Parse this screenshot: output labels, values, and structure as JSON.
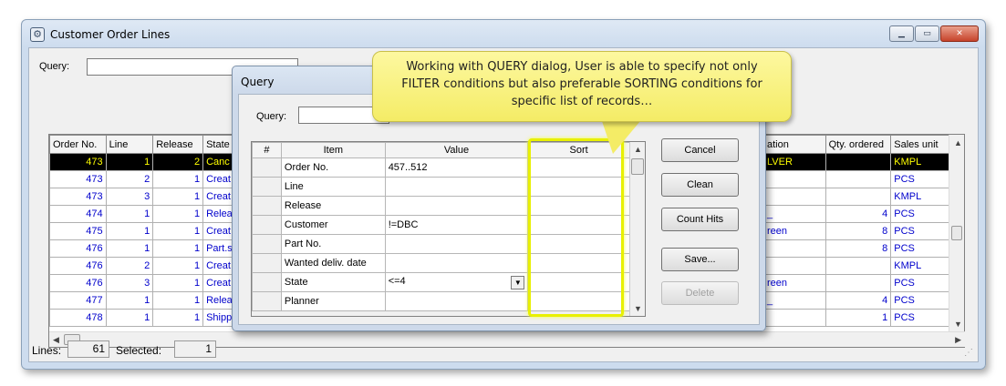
{
  "main": {
    "title": "Customer Order Lines",
    "query_label": "Query:",
    "columns_left": [
      "Order No.",
      "Line",
      "Release",
      "State"
    ],
    "columns_right": [
      "ation",
      "Qty. ordered",
      "Sales unit"
    ],
    "rows": [
      {
        "order": "473",
        "line": "1",
        "release": "2",
        "state": "Canc",
        "loc": "LVER",
        "qty": "",
        "unit": "KMPL",
        "selected": true
      },
      {
        "order": "473",
        "line": "2",
        "release": "1",
        "state": "Creat",
        "loc": "",
        "qty": "",
        "unit": "PCS"
      },
      {
        "order": "473",
        "line": "3",
        "release": "1",
        "state": "Creat",
        "loc": "",
        "qty": "",
        "unit": "KMPL"
      },
      {
        "order": "474",
        "line": "1",
        "release": "1",
        "state": "Relea",
        "loc": "_",
        "qty": "4",
        "unit": "PCS"
      },
      {
        "order": "475",
        "line": "1",
        "release": "1",
        "state": "Creat",
        "loc": "reen",
        "qty": "8",
        "unit": "PCS"
      },
      {
        "order": "476",
        "line": "1",
        "release": "1",
        "state": "Part.s",
        "loc": "",
        "qty": "8",
        "unit": "PCS"
      },
      {
        "order": "476",
        "line": "2",
        "release": "1",
        "state": "Creat",
        "loc": "",
        "qty": "",
        "unit": "KMPL"
      },
      {
        "order": "476",
        "line": "3",
        "release": "1",
        "state": "Creat",
        "loc": "reen",
        "qty": "",
        "unit": "PCS"
      },
      {
        "order": "477",
        "line": "1",
        "release": "1",
        "state": "Relea",
        "loc": "_",
        "qty": "4",
        "unit": "PCS"
      },
      {
        "order": "478",
        "line": "1",
        "release": "1",
        "state": "Shipp",
        "loc": "",
        "qty": "1",
        "unit": "PCS"
      }
    ],
    "status": {
      "lines_label": "Lines:",
      "lines_value": "61",
      "selected_label": "Selected:",
      "selected_value": "1"
    }
  },
  "dialog": {
    "title": "Query",
    "query_label": "Query:",
    "headers": [
      "#",
      "Item",
      "Value",
      "Sort"
    ],
    "items": [
      {
        "item": "Order No.",
        "value": "457..512"
      },
      {
        "item": "Line",
        "value": ""
      },
      {
        "item": "Release",
        "value": ""
      },
      {
        "item": "Customer",
        "value": "!=DBC"
      },
      {
        "item": "Part No.",
        "value": ""
      },
      {
        "item": "Wanted deliv. date",
        "value": ""
      },
      {
        "item": "State",
        "value": "<=4",
        "combo": true
      },
      {
        "item": "Planner",
        "value": ""
      }
    ],
    "buttons": {
      "cancel": "Cancel",
      "clean": "Clean",
      "count_hits": "Count Hits",
      "save": "Save...",
      "delete": "Delete"
    }
  },
  "callout": "Working with QUERY dialog, User is able to specify not only FILTER conditions but also preferable SORTING conditions for specific list of records…",
  "colors": {
    "selected_bg": "#000000",
    "selected_fg": "#ffff00",
    "link_blue": "#0000cc",
    "highlight": "#e8f000",
    "callout": "#f4ec66"
  }
}
